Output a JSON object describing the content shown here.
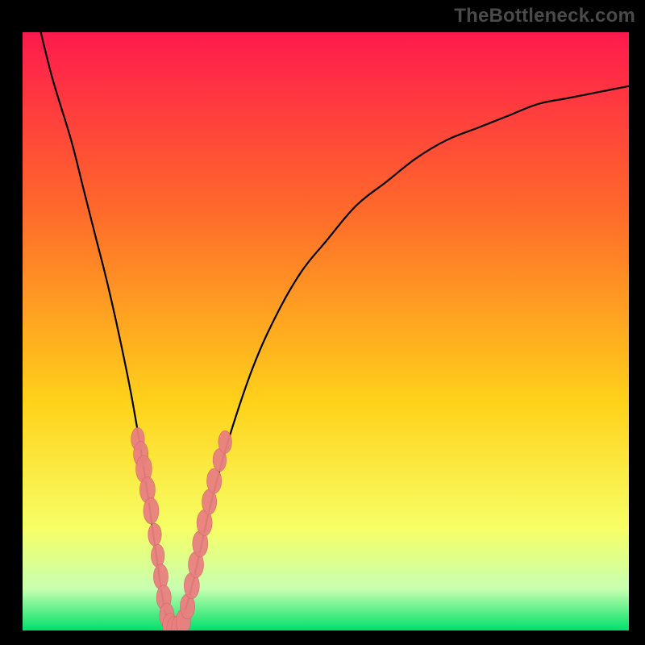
{
  "watermark": "TheBottleneck.com",
  "colors": {
    "frame_bg": "#000000",
    "grad_top": "#ff1a4d",
    "grad_upper_mid": "#ff6a2a",
    "grad_mid": "#ffd21a",
    "grad_lower_mid": "#f6ff66",
    "grad_lower": "#c8ffb0",
    "grad_bottom": "#00e06a",
    "curve": "#000000",
    "marker_fill": "#e98080",
    "marker_stroke": "#d06868",
    "watermark_text": "#4a4a4a"
  },
  "chart_data": {
    "type": "line",
    "title": "",
    "xlabel": "",
    "ylabel": "",
    "xlim": [
      0,
      100
    ],
    "ylim": [
      0,
      100
    ],
    "grid": false,
    "legend": "none",
    "annotations": [
      "TheBottleneck.com"
    ],
    "series": [
      {
        "name": "bottleneck-curve",
        "x": [
          3,
          5,
          8,
          10,
          12,
          14,
          16,
          18,
          20,
          22,
          23,
          24,
          25,
          27,
          29,
          31,
          34,
          38,
          42,
          46,
          50,
          55,
          60,
          65,
          70,
          75,
          80,
          85,
          90,
          95,
          100
        ],
        "y": [
          100,
          92,
          82,
          74,
          66,
          58,
          49,
          39,
          27,
          13,
          6,
          1,
          0,
          4,
          12,
          21,
          32,
          44,
          53,
          60,
          65,
          71,
          75,
          79,
          82,
          84,
          86,
          88,
          89,
          90,
          91
        ]
      }
    ],
    "markers_left": [
      {
        "x": 19.0,
        "y": 32.0,
        "size": 2.0
      },
      {
        "x": 19.5,
        "y": 29.5,
        "size": 2.2
      },
      {
        "x": 20.0,
        "y": 27.0,
        "size": 2.4
      },
      {
        "x": 20.6,
        "y": 23.5,
        "size": 2.3
      },
      {
        "x": 21.2,
        "y": 20.0,
        "size": 2.3
      },
      {
        "x": 21.8,
        "y": 16.0,
        "size": 2.0
      },
      {
        "x": 22.3,
        "y": 12.5,
        "size": 2.0
      },
      {
        "x": 22.8,
        "y": 9.0,
        "size": 2.2
      },
      {
        "x": 23.3,
        "y": 5.5,
        "size": 2.2
      },
      {
        "x": 23.8,
        "y": 2.5,
        "size": 2.2
      }
    ],
    "markers_bottom": [
      {
        "x": 24.3,
        "y": 0.8,
        "size": 2.2
      },
      {
        "x": 25.0,
        "y": 0.3,
        "size": 2.2
      },
      {
        "x": 25.8,
        "y": 0.5,
        "size": 2.2
      },
      {
        "x": 26.5,
        "y": 1.5,
        "size": 2.2
      }
    ],
    "markers_right": [
      {
        "x": 27.2,
        "y": 4.0,
        "size": 2.2
      },
      {
        "x": 27.9,
        "y": 7.5,
        "size": 2.3
      },
      {
        "x": 28.6,
        "y": 11.0,
        "size": 2.3
      },
      {
        "x": 29.3,
        "y": 14.5,
        "size": 2.3
      },
      {
        "x": 30.0,
        "y": 18.0,
        "size": 2.3
      },
      {
        "x": 30.8,
        "y": 21.5,
        "size": 2.2
      },
      {
        "x": 31.6,
        "y": 25.0,
        "size": 2.2
      },
      {
        "x": 32.5,
        "y": 28.5,
        "size": 2.0
      },
      {
        "x": 33.4,
        "y": 31.5,
        "size": 2.0
      }
    ]
  }
}
